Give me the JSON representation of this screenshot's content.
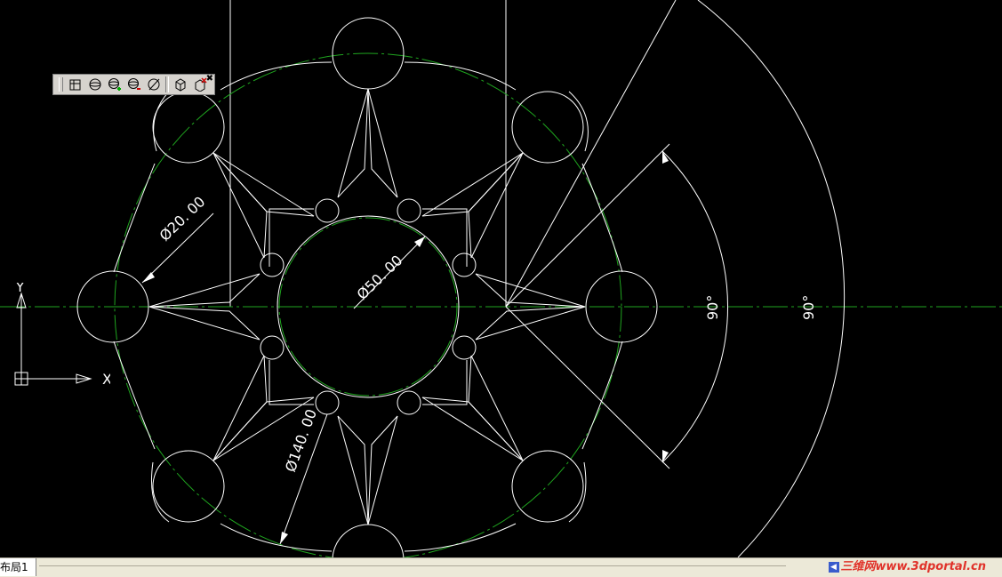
{
  "drawing": {
    "dimensions": {
      "dia_20": "Ø20. 00",
      "dia_50": "Ø50. 00",
      "dia_140": "Ø140. 00",
      "angle_inner": "90°",
      "angle_outer": "90°"
    }
  },
  "ucs": {
    "x_label": "X",
    "y_label": "Y"
  },
  "toolbar": {
    "buttons": [
      "3d-box-icon",
      "sphere-icon",
      "add-sphere-icon",
      "remove-sphere-icon",
      "slice-sphere-icon",
      "cube-icon",
      "close-cube-icon"
    ]
  },
  "statusbar": {
    "layout_tab": "布局1",
    "watermark": "三维网www.3dportal.cn"
  },
  "colors": {
    "background": "#000000",
    "geometry": "#ffffff",
    "centerline": "#1fa51f"
  }
}
